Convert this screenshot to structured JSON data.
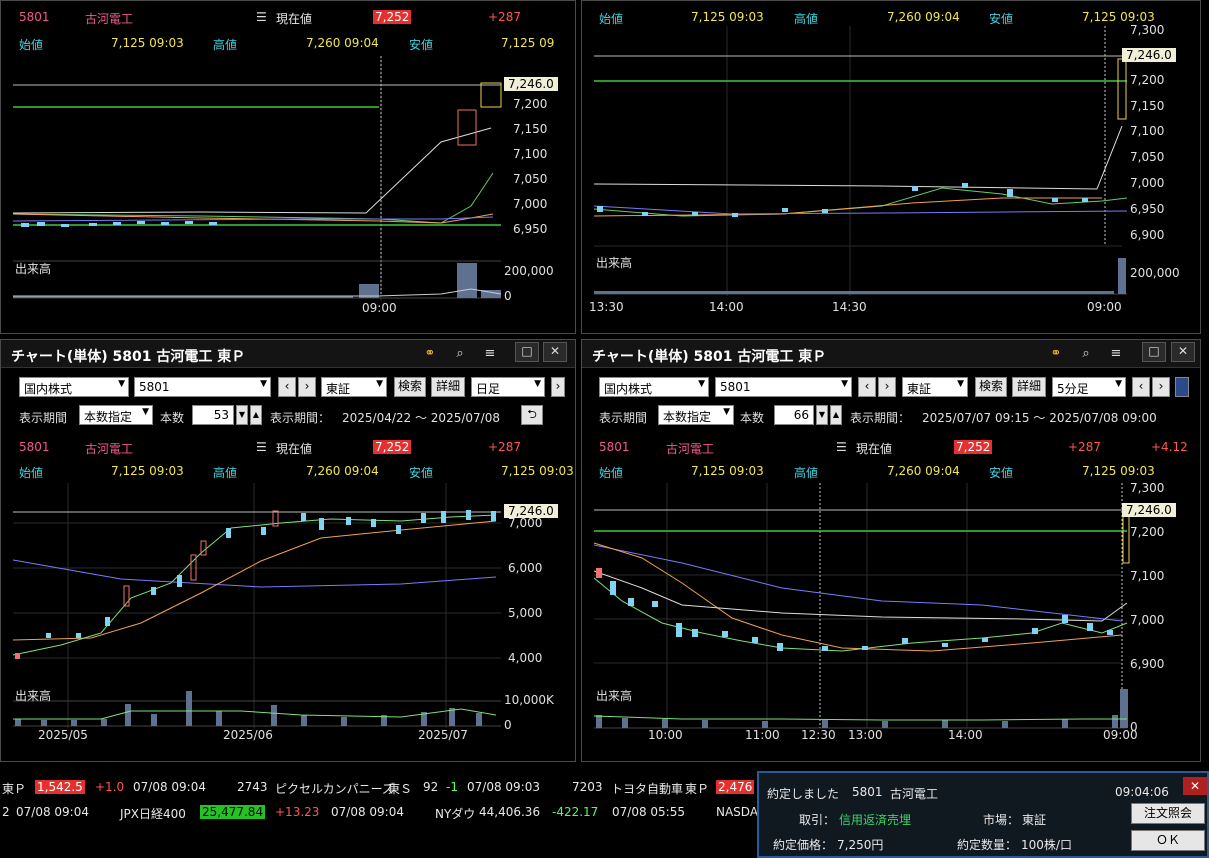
{
  "stock": {
    "code": "5801",
    "name": "古河電工",
    "current_label": "現在値",
    "price": "7,252",
    "change": "+287",
    "open_label": "始値",
    "open": "7,125 09:03",
    "high_label": "高値",
    "high": "7,260 09:04",
    "low_label": "安値",
    "low": "7,125 09:03",
    "low_clipped": "7,125 09",
    "pct": "+4.12"
  },
  "panels": {
    "tl": {
      "price_tag": "7,246.0",
      "yticks": [
        "7,200",
        "7,150",
        "7,100",
        "7,050",
        "7,000",
        "6,950"
      ],
      "vol_label": "出来高",
      "vol_tick": "200,000",
      "vol_zero": "0",
      "xticks": [
        "09:00"
      ]
    },
    "tr": {
      "price_tag": "7,246.0",
      "yticks": [
        "7,300",
        "7,250",
        "7,200",
        "7,150",
        "7,100",
        "7,050",
        "7,000",
        "6,950",
        "6,900"
      ],
      "vol_label": "出来高",
      "vol_tick": "200,000",
      "xticks": [
        "13:30",
        "14:00",
        "14:30",
        "09:00"
      ]
    },
    "bl": {
      "title": "チャート(単体) 5801 古河電工 東Ｐ",
      "market": "国内株式",
      "code": "5801",
      "exchange": "東証",
      "search": "検索",
      "detail": "詳細",
      "period": "日足",
      "period_label": "表示期間",
      "count_mode": "本数指定",
      "count_label": "本数",
      "count": "53",
      "range_label": "表示期間：",
      "range": "2025/04/22 ～ 2025/07/08",
      "price_tag": "7,246.0",
      "yticks": [
        "7,000",
        "6,000",
        "5,000",
        "4,000"
      ],
      "vol_label": "出来高",
      "vol_tick": "10,000K",
      "vol_zero": "0",
      "xticks": [
        "2025/05",
        "2025/06",
        "2025/07"
      ]
    },
    "br": {
      "title": "チャート(単体) 5801 古河電工 東Ｐ",
      "market": "国内株式",
      "code": "5801",
      "exchange": "東証",
      "search": "検索",
      "detail": "詳細",
      "period": "5分足",
      "period_label": "表示期間",
      "count_mode": "本数指定",
      "count_label": "本数",
      "count": "66",
      "range_label": "表示期間：",
      "range": "2025/07/07 09:15 ～ 2025/07/08 09:00",
      "price_tag": "7,246.0",
      "yticks": [
        "7,300",
        "7,200",
        "7,100",
        "7,000",
        "6,900"
      ],
      "vol_label": "出来高",
      "vol_zero": "0",
      "xticks": [
        "10:00",
        "11:00",
        "12:30",
        "13:00",
        "14:00",
        "09:00"
      ]
    }
  },
  "ticker1": [
    {
      "t": "東Ｐ",
      "c": "white"
    },
    {
      "t": "1,542.5",
      "c": "redbox"
    },
    {
      "t": "+1.0",
      "c": "red"
    },
    {
      "t": "07/08 09:04",
      "c": "white"
    },
    {
      "t": "2743",
      "c": "white"
    },
    {
      "t": "ピクセルカンパニーズ",
      "c": "white"
    },
    {
      "t": "東Ｓ",
      "c": "white"
    },
    {
      "t": "92",
      "c": "white"
    },
    {
      "t": "-1",
      "c": "green"
    },
    {
      "t": "07/08 09:03",
      "c": "white"
    },
    {
      "t": "7203",
      "c": "white"
    },
    {
      "t": "トヨタ自動車",
      "c": "white"
    },
    {
      "t": "東Ｐ",
      "c": "white"
    },
    {
      "t": "2,476",
      "c": "redbox"
    }
  ],
  "ticker2": [
    {
      "t": "2",
      "c": "white"
    },
    {
      "t": "07/08 09:04",
      "c": "white"
    },
    {
      "t": "JPX日経400",
      "c": "white"
    },
    {
      "t": "25,477.84",
      "c": "greenbox"
    },
    {
      "t": "+13.23",
      "c": "red"
    },
    {
      "t": "07/08 09:04",
      "c": "white"
    },
    {
      "t": "NYダウ",
      "c": "white"
    },
    {
      "t": "44,406.36",
      "c": "white"
    },
    {
      "t": "-422.17",
      "c": "green"
    },
    {
      "t": "07/08 05:55",
      "c": "white"
    },
    {
      "t": "NASDA",
      "c": "white"
    }
  ],
  "dialog": {
    "title": "約定しました",
    "code": "5801",
    "name": "古河電工",
    "time": "09:04:06",
    "trade_label": "取引：",
    "trade": "信用返済売埋",
    "market_label": "市場：",
    "market": "東証",
    "price_label": "約定価格：",
    "price": "7,250円",
    "qty_label": "約定数量：",
    "qty": "100株/口",
    "order_btn": "注文照会",
    "ok_btn": "ＯＫ",
    "close": "✕"
  }
}
